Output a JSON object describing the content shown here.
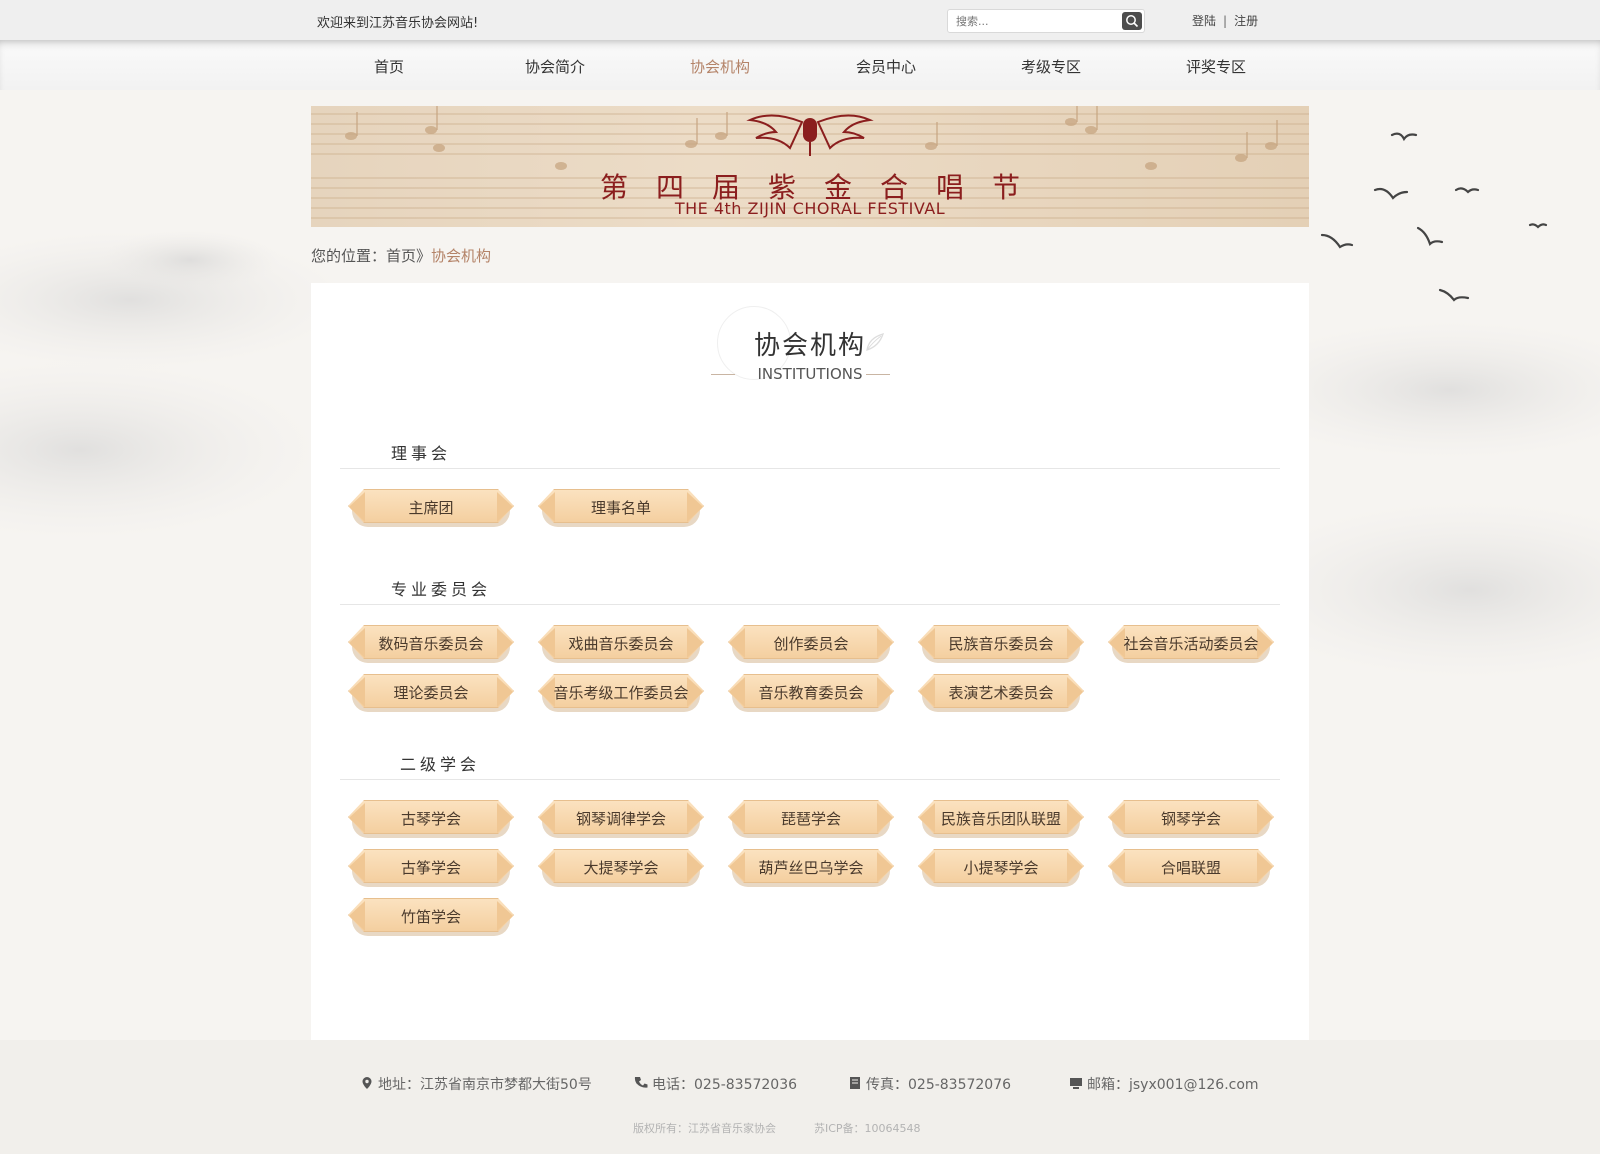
{
  "topbar": {
    "welcome": "欢迎来到江苏音乐协会网站!",
    "search_placeholder": "搜索...",
    "login": "登陆",
    "separator": "|",
    "register": "注册"
  },
  "nav": [
    {
      "label": "首页",
      "active": false
    },
    {
      "label": "协会简介",
      "active": false
    },
    {
      "label": "协会机构",
      "active": true
    },
    {
      "label": "会员中心",
      "active": false
    },
    {
      "label": "考级专区",
      "active": false
    },
    {
      "label": "评奖专区",
      "active": false
    }
  ],
  "banner": {
    "title": "第四届紫金合唱节",
    "subtitle": "THE 4th ZIJIN CHORAL FESTIVAL"
  },
  "breadcrumb": {
    "prefix": "您的位置：",
    "home": "首页",
    "arrow": "》",
    "current": "协会机构"
  },
  "heading": {
    "cn": "协会机构",
    "en": "INSTITUTIONS"
  },
  "sections": [
    {
      "title": "理事会",
      "items": [
        "主席团",
        "理事名单"
      ]
    },
    {
      "title": "专业委员会",
      "items": [
        "数码音乐委员会",
        "戏曲音乐委员会",
        "创作委员会",
        "民族音乐委员会",
        "社会音乐活动委员会",
        "理论委员会",
        "音乐考级工作委员会",
        "音乐教育委员会",
        "表演艺术委员会"
      ]
    },
    {
      "title": "二级学会",
      "items": [
        "古琴学会",
        "钢琴调律学会",
        "琵琶学会",
        "民族音乐团队联盟",
        "钢琴学会",
        "古筝学会",
        "大提琴学会",
        "葫芦丝巴乌学会",
        "小提琴学会",
        "合唱联盟",
        "竹笛学会"
      ]
    }
  ],
  "footer": {
    "address": "地址：江苏省南京市梦都大街50号",
    "phone": "电话：025-83572036",
    "fax": "传真：025-83572076",
    "email": "邮箱：jsyx001@126.com",
    "copyright": "版权所有：江苏省音乐家协会",
    "icp": "苏ICP备：10064548"
  },
  "colors": {
    "accent": "#b48368",
    "banner_text": "#8b1e1e",
    "pill_fill": "#f6d7ad"
  }
}
